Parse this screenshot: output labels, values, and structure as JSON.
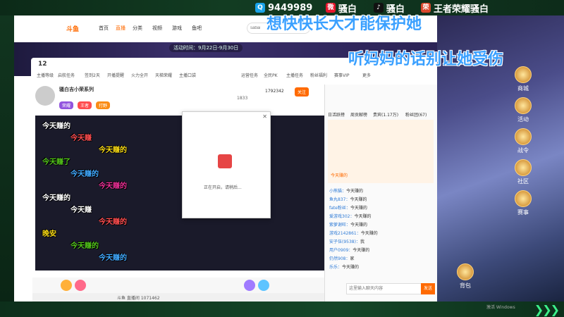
{
  "socials": [
    {
      "icon": "qq-icon",
      "label": "9449989",
      "color": "#1aa3e8",
      "glyph": "Q"
    },
    {
      "icon": "weibo-icon",
      "label": "骚白",
      "color": "#e6162d",
      "glyph": "微"
    },
    {
      "icon": "douyin-icon",
      "label": "骚白",
      "color": "#111111",
      "glyph": "♪"
    },
    {
      "icon": "game-icon",
      "label": "王者荣耀骚白",
      "color": "#d9472b",
      "glyph": "荣"
    }
  ],
  "overlay": {
    "line1": "想快快长大才能保护她",
    "line2": "听妈妈的话别让她受伤"
  },
  "site": {
    "logo": "斗鱼",
    "nav": [
      "首页",
      "直播",
      "分类",
      "视频",
      "游戏",
      "鱼吧"
    ],
    "search_placeholder": "sabai",
    "banner": "活动时间：9月22日-9月30日",
    "bar_items": [
      "主播等级",
      "启航任务",
      "签到2天",
      "开播提醒",
      "火力全开",
      "天梯荣耀",
      "主播口袋",
      "运营任务",
      "全民PK",
      "主播任务",
      "粉丝福利",
      "赛事VIP",
      "更多"
    ],
    "level_badge": "12"
  },
  "streamer": {
    "name": "骚白吉小荣系列",
    "fans_label": "关注",
    "fans": "1792342",
    "hot": "1833",
    "tags": [
      "荣耀",
      "王者",
      "打野"
    ]
  },
  "danmaku": [
    "今天赚的",
    "今天赚",
    "今天赚的",
    "今天赚了",
    "今天赚的",
    "今天赚的",
    "今天赚的",
    "今天赚",
    "今天赚的",
    "晚安",
    "今天赚的",
    "今天赚的",
    "今天赚的",
    "今天赚的",
    "今天赚的",
    "今天赚的",
    "晚安",
    "今天赚的",
    "今天赚的",
    "今天赚的"
  ],
  "dialog": {
    "text": "正在开启，请稍后..."
  },
  "chat": {
    "tabs": [
      "日活跃榜",
      "周贡献榜",
      "贵宾(1.17万)",
      "粉丝团(67)"
    ],
    "notice": "今天赚的",
    "messages": [
      {
        "user": "小熊猫",
        "text": "今天赚的"
      },
      {
        "user": "鱼丸837",
        "text": "今天赚的"
      },
      {
        "user": "fate粉丝",
        "text": "今天赚的"
      },
      {
        "user": "爱游戏302",
        "text": "今天赚的"
      },
      {
        "user": "紫萝谢旺",
        "text": "今天赚的"
      },
      {
        "user": "游戏2142861",
        "text": "今天赚的"
      },
      {
        "user": "安子伍(9538)",
        "text": "我"
      },
      {
        "user": "用户0909",
        "text": "今天赚的"
      },
      {
        "user": "仍然908",
        "text": "家"
      },
      {
        "user": "乐乐",
        "text": "今天赚的"
      }
    ],
    "input_placeholder": "这里输入聊天内容",
    "send_label": "发送"
  },
  "game_menu": [
    "商城",
    "活动",
    "战令",
    "社区",
    "赛事",
    "背包"
  ],
  "bottom_info": "斗鱼 直播间 1071462",
  "watermark": "激活 Windows"
}
